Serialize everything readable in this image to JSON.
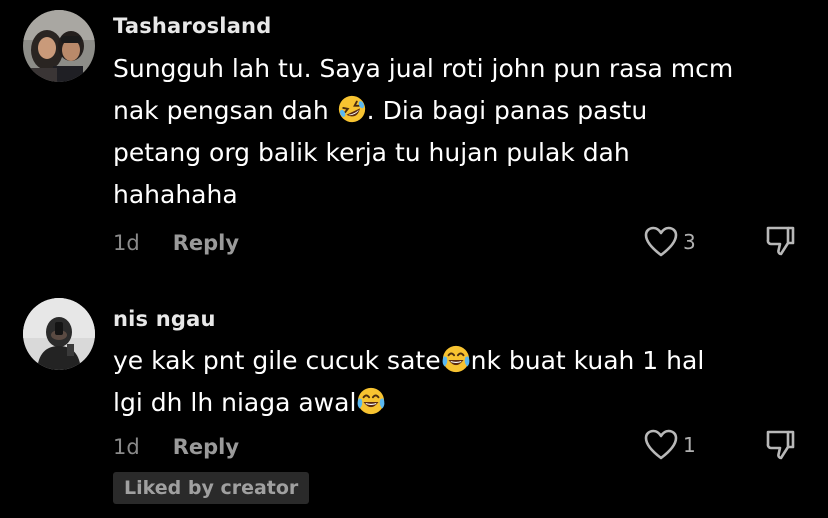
{
  "comments": [
    {
      "username": "Tasharosland",
      "text_part1": "Sungguh lah tu. Saya jual roti john pun rasa mcm\nnak pengsan dah ",
      "emoji1": "rolling-on-floor-laughing",
      "text_part2": ". Dia bagi panas pastu\npetang org balik kerja tu hujan pulak dah\nhahahaha",
      "timestamp": "1d",
      "reply_label": "Reply",
      "like_count": "3"
    },
    {
      "username": "nis ngau",
      "text_part1": "ye kak pnt gile cucuk sate",
      "emoji1": "face-with-tears-of-joy",
      "text_part2": "nk buat kuah 1 hal\nlgi dh lh niaga awal",
      "emoji2": "face-with-tears-of-joy",
      "timestamp": "1d",
      "reply_label": "Reply",
      "like_count": "1",
      "badge": "Liked by creator"
    }
  ],
  "colors": {
    "background": "#000000",
    "text": "#ffffff",
    "muted": "#8a8a8a",
    "badge_bg": "#2a2a2a"
  }
}
